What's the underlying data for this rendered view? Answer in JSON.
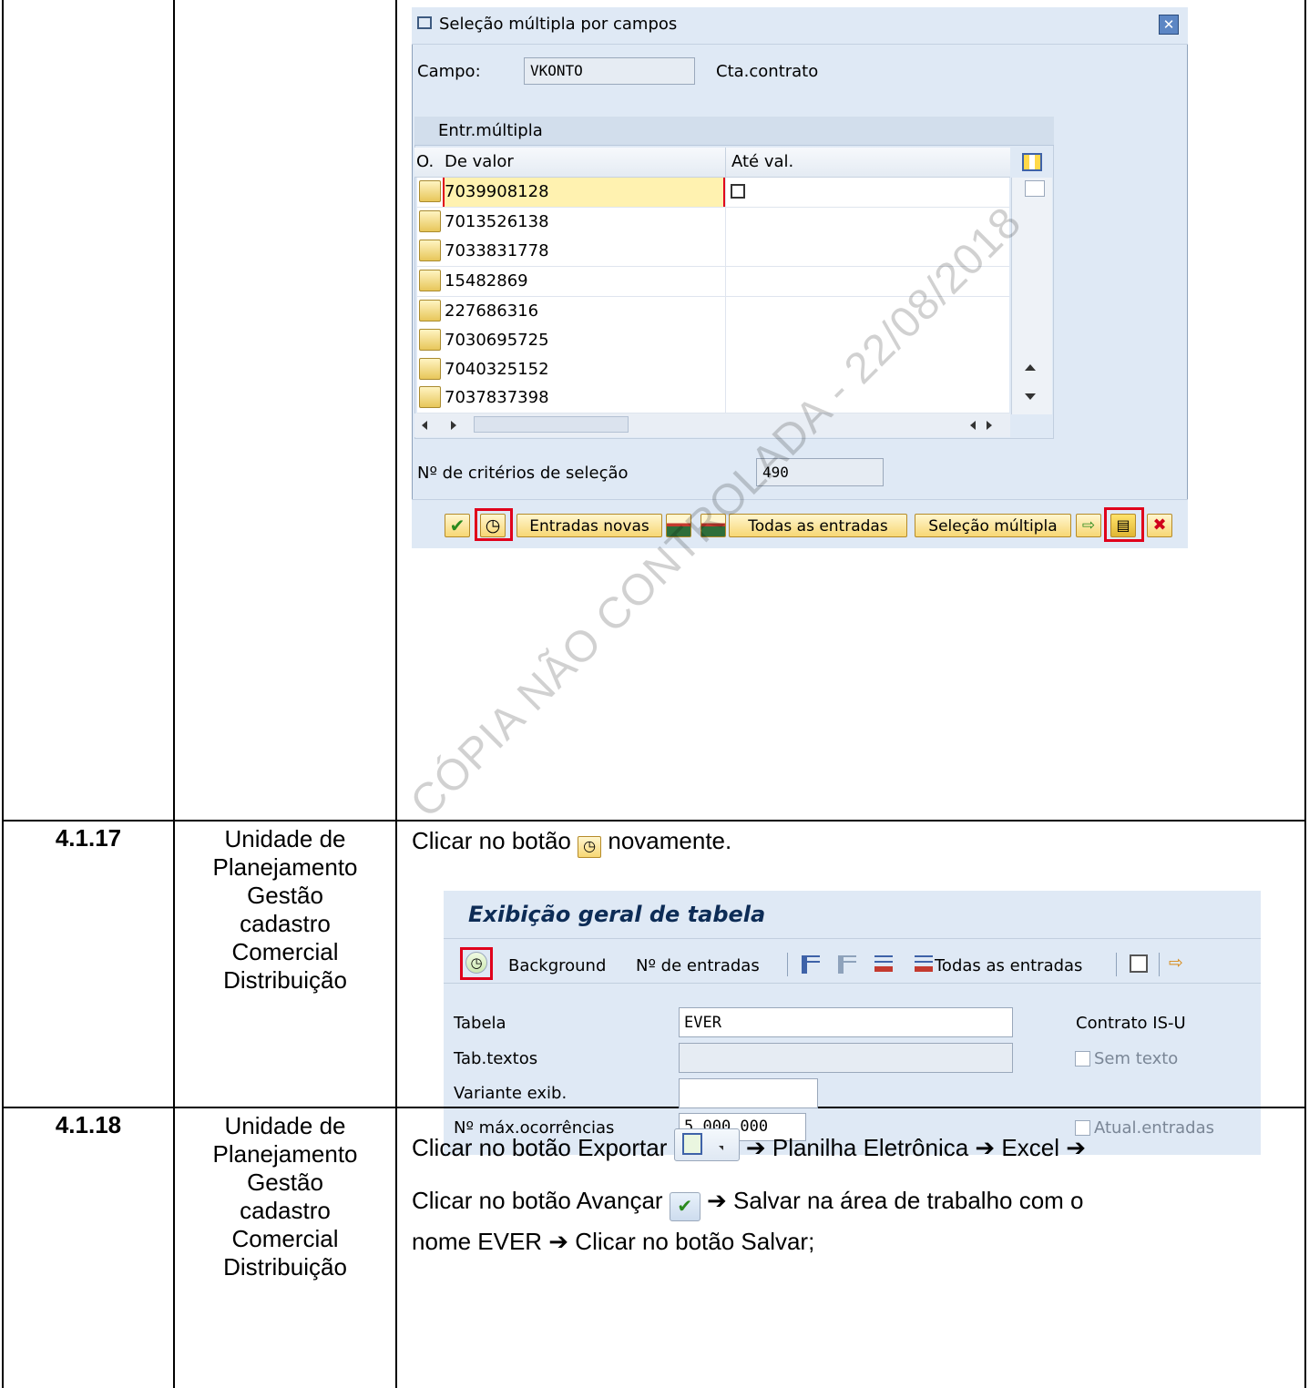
{
  "rows": [
    {
      "number": "",
      "unit": [],
      "instruction": ""
    },
    {
      "number": "4.1.17",
      "unit": [
        "Unidade de",
        "Planejamento",
        "Gestão",
        "cadastro",
        "Comercial",
        "Distribuição"
      ],
      "instruction_before": "Clicar no botão",
      "instruction_after": "novamente."
    },
    {
      "number": "4.1.18",
      "unit": [
        "Unidade de",
        "Planejamento",
        "Gestão",
        "cadastro",
        "Comercial",
        "Distribuição"
      ],
      "line1_a": "Clicar no botão Exportar",
      "line1_b": "➔ Planilha Eletrônica ➔ Excel ➔",
      "line2_a": "Clicar no botão Avançar",
      "line2_b": "➔ Salvar na área de trabalho com o",
      "line3": "nome EVER ➔ Clicar no botão Salvar;"
    }
  ],
  "dialog": {
    "title": "Seleção múltipla por campos",
    "field_label": "Campo:",
    "field_value": "VKONTO",
    "field_desc": "Cta.contrato",
    "section_tab": "Entr.múltipla",
    "col_o": "O.",
    "col_from": "De valor",
    "col_to": "Até val.",
    "values": [
      "7039908128",
      "7013526138",
      "7033831778",
      "15482869",
      "227686316",
      "7030695725",
      "7040325152",
      "7037837398"
    ],
    "criteria_label": "Nº de critérios de seleção",
    "criteria_value": "490",
    "btn_new": "Entradas novas",
    "btn_all": "Todas as entradas",
    "btn_multi": "Seleção múltipla"
  },
  "screen2": {
    "title": "Exibição geral de tabela",
    "tb_background": "Background",
    "tb_entries": "Nº de entradas",
    "tb_all": "Todas as entradas",
    "labels": {
      "table": "Tabela",
      "texts": "Tab.textos",
      "variant": "Variante exib.",
      "max": "Nº máx.ocorrências"
    },
    "values": {
      "table": "EVER",
      "texts": "",
      "variant": "",
      "max": "5.000.000"
    },
    "desc": "Contrato IS-U",
    "chk_text": "Sem texto",
    "chk_update": "Atual.entradas"
  },
  "watermark": "CÓPIA NÃO CONTROLADA - 22/08/2018",
  "colors": {
    "sap_bg": "#dfe9f5",
    "highlight_red": "#e0001b",
    "selected_row": "#fff2b0"
  }
}
